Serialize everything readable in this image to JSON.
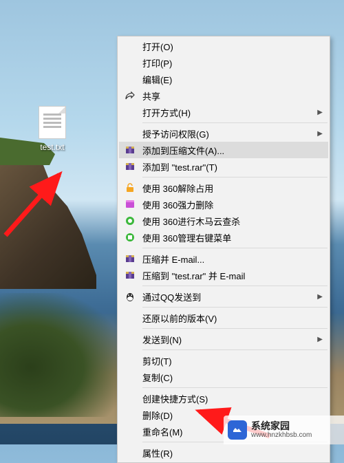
{
  "desktop": {
    "file_label": "test.txt"
  },
  "menu": {
    "open": "打开(O)",
    "print": "打印(P)",
    "edit": "编辑(E)",
    "share": "共享",
    "open_with": "打开方式(H)",
    "grant_access": "授予访问权限(G)",
    "add_archive": "添加到压缩文件(A)...",
    "add_to_rar": "添加到 \"test.rar\"(T)",
    "unlock_360": "使用 360解除占用",
    "forcedel_360": "使用 360强力删除",
    "scan_360": "使用 360进行木马云查杀",
    "menu_360": "使用 360管理右键菜单",
    "zip_email": "压缩并 E-mail...",
    "zip_to_email": "压缩到 \"test.rar\" 并 E-mail",
    "send_qq": "通过QQ发送到",
    "restore_prev": "还原以前的版本(V)",
    "send_to": "发送到(N)",
    "cut": "剪切(T)",
    "copy": "复制(C)",
    "create_shortcut": "创建快捷方式(S)",
    "delete": "删除(D)",
    "rename": "重命名(M)",
    "properties": "属性(R)"
  },
  "watermark": {
    "title": "系统家园",
    "url": "www.hnzkhbsb.com"
  }
}
